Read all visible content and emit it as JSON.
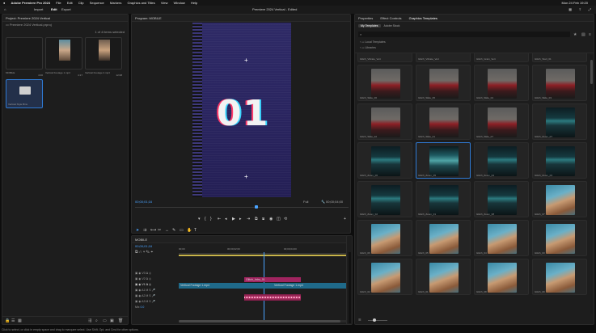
{
  "menubar": {
    "apple": "",
    "items": [
      "Adobe Premiere Pro 2024",
      "File",
      "Edit",
      "Clip",
      "Sequence",
      "Markers",
      "Graphics and Titles",
      "View",
      "Window",
      "Help"
    ],
    "right": "Mon 24 Feb  19:20"
  },
  "appbar": {
    "nav": [
      "Import",
      "Edit",
      "Export"
    ],
    "active_nav": "Edit",
    "title": "Premiere 2024 Vertical - Edited"
  },
  "project": {
    "title": "Project: Premiere 2024 Vertical",
    "path": "Premiere 2024 Vertical.prproj",
    "count": "1 of 4 items selected",
    "items": [
      {
        "name": "MOBILE",
        "dur": "4:00",
        "kind": "seq"
      },
      {
        "name": "Vertical Footage 1.mp4",
        "dur": "4:17",
        "kind": "clip"
      },
      {
        "name": "Vertical Footage 2.mp4",
        "dur": "12:08",
        "kind": "clip"
      },
      {
        "name": "Vertical Style Bins",
        "dur": "",
        "kind": "bin"
      }
    ]
  },
  "program": {
    "title": "Program: MOBILE",
    "overlay_text": "01",
    "timecode_left": "00;00;01;16",
    "fit": "Fit",
    "quality": "Full",
    "timecode_right": "00;00;04;00"
  },
  "timeline": {
    "tab": "MOBILE",
    "timecode": "00;00;01;16",
    "ruler": [
      "00;00",
      "00;00;02;00",
      "00;00;04;00"
    ],
    "tracks_video": [
      "V3",
      "V2",
      "V1"
    ],
    "tracks_audio": [
      "A1",
      "A2",
      "A3"
    ],
    "mix": "Mix",
    "mix_val": "0.0",
    "clips": [
      {
        "label": "Vertical Footage 1.mp4",
        "track": "V1",
        "color": "#1f6a8a"
      },
      {
        "label": "Vertical Footage 1.mp4",
        "track": "V1b",
        "color": "#1f6a8a"
      },
      {
        "label": "Glitch_Intro_01",
        "track": "V2",
        "color": "#a0245f"
      }
    ]
  },
  "graphics": {
    "tabs": [
      "Properties",
      "Effect Controls",
      "Graphics Templates"
    ],
    "active_tab": "Graphics Templates",
    "subtabs": [
      "My Templates",
      "Adobe Stock"
    ],
    "search_placeholder": "",
    "folders": [
      "Local Templates",
      "Libraries"
    ],
    "top_labels": [
      "Glitch_Vibrate_Vert",
      "Glitch_Vibrate_Vert",
      "Glitch_Grain_Vert",
      "Glitch_Start_01"
    ],
    "rows": [
      {
        "style": [
          "car",
          "car",
          "car",
          "car"
        ],
        "labels": [
          "Glitch_Slide_06",
          "Glitch_Slide_05",
          "Glitch_Slide_04",
          "Glitch_Slide_03"
        ]
      },
      {
        "style": [
          "car",
          "car",
          "car",
          "teal"
        ],
        "labels": [
          "Glitch_Slide_02",
          "Glitch_Slide_01",
          "Glitch_Slide_07",
          "Glitch_Zoom_07"
        ]
      },
      {
        "style": [
          "teal",
          "teal2",
          "teal",
          "teal"
        ],
        "labels": [
          "Glitch_Zoom_06",
          "Glitch_Zoom_05",
          "Glitch_Zoom_04",
          "Glitch_Zoom_03"
        ]
      },
      {
        "style": [
          "teal",
          "teal",
          "teal",
          "girl"
        ],
        "labels": [
          "Glitch_Zoom_02",
          "Glitch_Zoom_01",
          "Glitch_Zoom_08",
          "Glitch_07"
        ]
      },
      {
        "style": [
          "girl",
          "girl",
          "girl",
          "girl"
        ],
        "labels": [
          "Glitch_06",
          "Glitch_05",
          "Glitch_04",
          "Glitch_03"
        ]
      },
      {
        "style": [
          "girl",
          "girl",
          "girl",
          "girl"
        ],
        "labels": [
          "Glitch_02",
          "Glitch_01",
          "Glitch_08",
          "Glitch_09"
        ]
      }
    ]
  },
  "status": "Click to select, or click in empty space and drag to marquee select. Use Shift, Opt, and Cmd for other options."
}
